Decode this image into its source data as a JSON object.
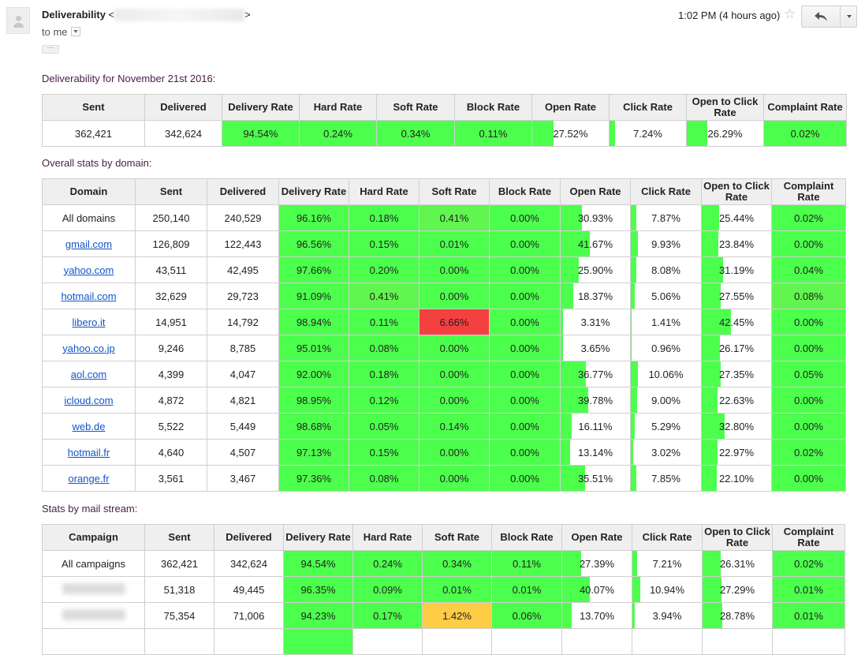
{
  "email": {
    "sender_name": "Deliverability",
    "recipient_text": "to me",
    "time": "1:02 PM (4 hours ago)",
    "icons": [
      "avatar",
      "star-icon",
      "reply-icon",
      "more-icon"
    ]
  },
  "section1": {
    "heading": "Deliverability for November 21st 2016:",
    "headers": [
      "Sent",
      "Delivered",
      "Delivery Rate",
      "Hard Rate",
      "Soft Rate",
      "Block Rate",
      "Open Rate",
      "Click Rate",
      "Open to Click Rate",
      "Complaint Rate"
    ],
    "row": [
      "362,421",
      "342,624",
      "94.54%",
      "0.24%",
      "0.34%",
      "0.11%",
      "27.52%",
      "7.24%",
      "26.29%",
      "0.02%"
    ]
  },
  "section2": {
    "heading": "Overall stats by domain:",
    "headers": [
      "Domain",
      "Sent",
      "Delivered",
      "Delivery Rate",
      "Hard Rate",
      "Soft Rate",
      "Block Rate",
      "Open Rate",
      "Click Rate",
      "Open to Click Rate",
      "Complaint Rate"
    ],
    "rows": [
      [
        "All domains",
        "250,140",
        "240,529",
        "96.16%",
        "0.18%",
        "0.41%",
        "0.00%",
        "30.93%",
        "7.87%",
        "25.44%",
        "0.02%"
      ],
      [
        "gmail.com",
        "126,809",
        "122,443",
        "96.56%",
        "0.15%",
        "0.01%",
        "0.00%",
        "41.67%",
        "9.93%",
        "23.84%",
        "0.00%"
      ],
      [
        "yahoo.com",
        "43,511",
        "42,495",
        "97.66%",
        "0.20%",
        "0.00%",
        "0.00%",
        "25.90%",
        "8.08%",
        "31.19%",
        "0.04%"
      ],
      [
        "hotmail.com",
        "32,629",
        "29,723",
        "91.09%",
        "0.41%",
        "0.00%",
        "0.00%",
        "18.37%",
        "5.06%",
        "27.55%",
        "0.08%"
      ],
      [
        "libero.it",
        "14,951",
        "14,792",
        "98.94%",
        "0.11%",
        "6.66%",
        "0.00%",
        "3.31%",
        "1.41%",
        "42.45%",
        "0.00%"
      ],
      [
        "yahoo.co.jp",
        "9,246",
        "8,785",
        "95.01%",
        "0.08%",
        "0.00%",
        "0.00%",
        "3.65%",
        "0.96%",
        "26.17%",
        "0.00%"
      ],
      [
        "aol.com",
        "4,399",
        "4,047",
        "92.00%",
        "0.18%",
        "0.00%",
        "0.00%",
        "36.77%",
        "10.06%",
        "27.35%",
        "0.05%"
      ],
      [
        "icloud.com",
        "4,872",
        "4,821",
        "98.95%",
        "0.12%",
        "0.00%",
        "0.00%",
        "39.78%",
        "9.00%",
        "22.63%",
        "0.00%"
      ],
      [
        "web.de",
        "5,522",
        "5,449",
        "98.68%",
        "0.05%",
        "0.14%",
        "0.00%",
        "16.11%",
        "5.29%",
        "32.80%",
        "0.00%"
      ],
      [
        "hotmail.fr",
        "4,640",
        "4,507",
        "97.13%",
        "0.15%",
        "0.00%",
        "0.00%",
        "13.14%",
        "3.02%",
        "22.97%",
        "0.02%"
      ],
      [
        "orange.fr",
        "3,561",
        "3,467",
        "97.36%",
        "0.08%",
        "0.00%",
        "0.00%",
        "35.51%",
        "7.85%",
        "22.10%",
        "0.00%"
      ]
    ]
  },
  "section3": {
    "heading": "Stats by mail stream:",
    "headers": [
      "Campaign",
      "Sent",
      "Delivered",
      "Delivery Rate",
      "Hard Rate",
      "Soft Rate",
      "Block Rate",
      "Open Rate",
      "Click Rate",
      "Open to Click Rate",
      "Complaint Rate"
    ],
    "rows": [
      [
        "All campaigns",
        "362,421",
        "342,624",
        "94.54%",
        "0.24%",
        "0.34%",
        "0.11%",
        "27.39%",
        "7.21%",
        "26.31%",
        "0.02%"
      ],
      [
        "",
        "51,318",
        "49,445",
        "96.35%",
        "0.09%",
        "0.01%",
        "0.01%",
        "40.07%",
        "10.94%",
        "27.29%",
        "0.01%"
      ],
      [
        "",
        "75,354",
        "71,006",
        "94.23%",
        "0.17%",
        "1.42%",
        "0.06%",
        "13.70%",
        "3.94%",
        "28.78%",
        "0.01%"
      ]
    ]
  },
  "colors": {
    "good": "#4dff4d",
    "warn": "#ffcc45",
    "bad": "#f44040",
    "heading": "#4b1b4c",
    "link": "#1155cc"
  }
}
